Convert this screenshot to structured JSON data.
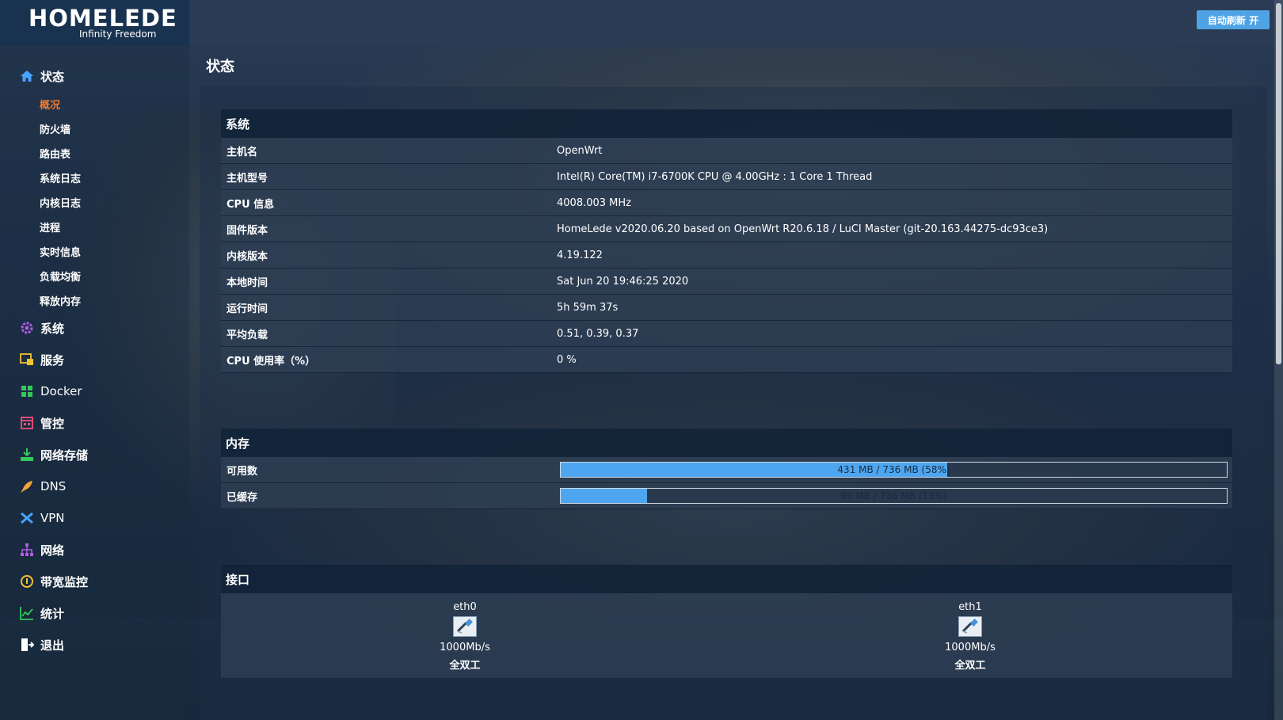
{
  "brand": {
    "name": "HOMELEDE",
    "tagline": "Infinity Freedom"
  },
  "topbar": {
    "auto_refresh_label": "自动刷新 开"
  },
  "sidebar": {
    "status": {
      "label": "状态",
      "children": [
        "概况",
        "防火墙",
        "路由表",
        "系统日志",
        "内核日志",
        "进程",
        "实时信息",
        "负载均衡",
        "释放内存"
      ]
    },
    "items": [
      {
        "label": "系统",
        "icon": "gear-icon"
      },
      {
        "label": "服务",
        "icon": "services-icon"
      },
      {
        "label": "Docker",
        "icon": "docker-icon"
      },
      {
        "label": "管控",
        "icon": "control-icon"
      },
      {
        "label": "网络存储",
        "icon": "storage-icon"
      },
      {
        "label": "DNS",
        "icon": "rocket-icon"
      },
      {
        "label": "VPN",
        "icon": "vpn-icon"
      },
      {
        "label": "网络",
        "icon": "network-icon"
      },
      {
        "label": "带宽监控",
        "icon": "bandwidth-icon"
      },
      {
        "label": "统计",
        "icon": "chart-icon"
      },
      {
        "label": "退出",
        "icon": "logout-icon"
      }
    ],
    "colors": {
      "status": "#4aa3ff",
      "system": "#b05ee8",
      "services": "#f2c230",
      "docker": "#34c85a",
      "control": "#f0507a",
      "storage": "#34c85a",
      "dns": "#f3a33b",
      "vpn": "#4aa3ff",
      "network": "#b05ee8",
      "bandwidth": "#f2c230",
      "stats": "#34c85a",
      "logout": "#ffffff"
    }
  },
  "page": {
    "title": "状态"
  },
  "system": {
    "title": "系统",
    "rows": [
      {
        "key": "主机名",
        "value": "OpenWrt"
      },
      {
        "key": "主机型号",
        "value": "Intel(R) Core(TM) i7-6700K CPU @ 4.00GHz : 1 Core 1 Thread"
      },
      {
        "key": "CPU 信息",
        "value": "4008.003 MHz"
      },
      {
        "key": "固件版本",
        "value": "HomeLede v2020.06.20 based on OpenWrt R20.6.18 / LuCI Master (git-20.163.44275-dc93ce3)"
      },
      {
        "key": "内核版本",
        "value": "4.19.122"
      },
      {
        "key": "本地时间",
        "value": "Sat Jun 20 19:46:25 2020"
      },
      {
        "key": "运行时间",
        "value": "5h 59m 37s"
      },
      {
        "key": "平均负载",
        "value": "0.51, 0.39, 0.37"
      },
      {
        "key": "CPU 使用率（%）",
        "value": "0 %"
      }
    ]
  },
  "memory": {
    "title": "内存",
    "rows": [
      {
        "key": "可用数",
        "text": "431 MB / 736 MB (58%)",
        "percent": 58
      },
      {
        "key": "已缓存",
        "text": "99 MB / 736 MB (13%)",
        "percent": 13
      }
    ]
  },
  "interfaces": {
    "title": "接口",
    "items": [
      {
        "name": "eth0",
        "speed": "1000Mb/s",
        "duplex": "全双工"
      },
      {
        "name": "eth1",
        "speed": "1000Mb/s",
        "duplex": "全双工"
      }
    ]
  },
  "theme": {
    "accent": "#4da6ef",
    "active_menu": "#f07a2c"
  }
}
